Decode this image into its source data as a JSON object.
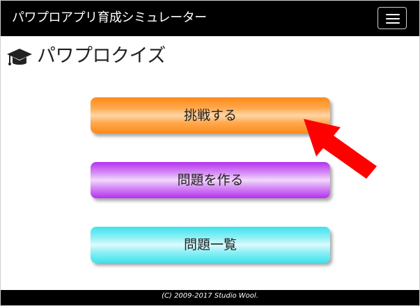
{
  "navbar": {
    "brand": "パワプロアプリ育成シミュレーター",
    "menu_icon": "hamburger-icon"
  },
  "heading": {
    "icon": "graduation-cap-icon",
    "title": "パワプロクイズ"
  },
  "buttons": {
    "challenge_label": "挑戦する",
    "create_label": "問題を作る",
    "list_label": "問題一覧"
  },
  "annotation": {
    "icon": "red-arrow-icon",
    "color": "#ff0000"
  },
  "footer": {
    "copyright": "(C) 2009-2017 Studio Wool."
  },
  "colors": {
    "navbar": "#000000",
    "challenge": "#ff8a1a",
    "create": "#b531ee",
    "list": "#3de3ee"
  }
}
